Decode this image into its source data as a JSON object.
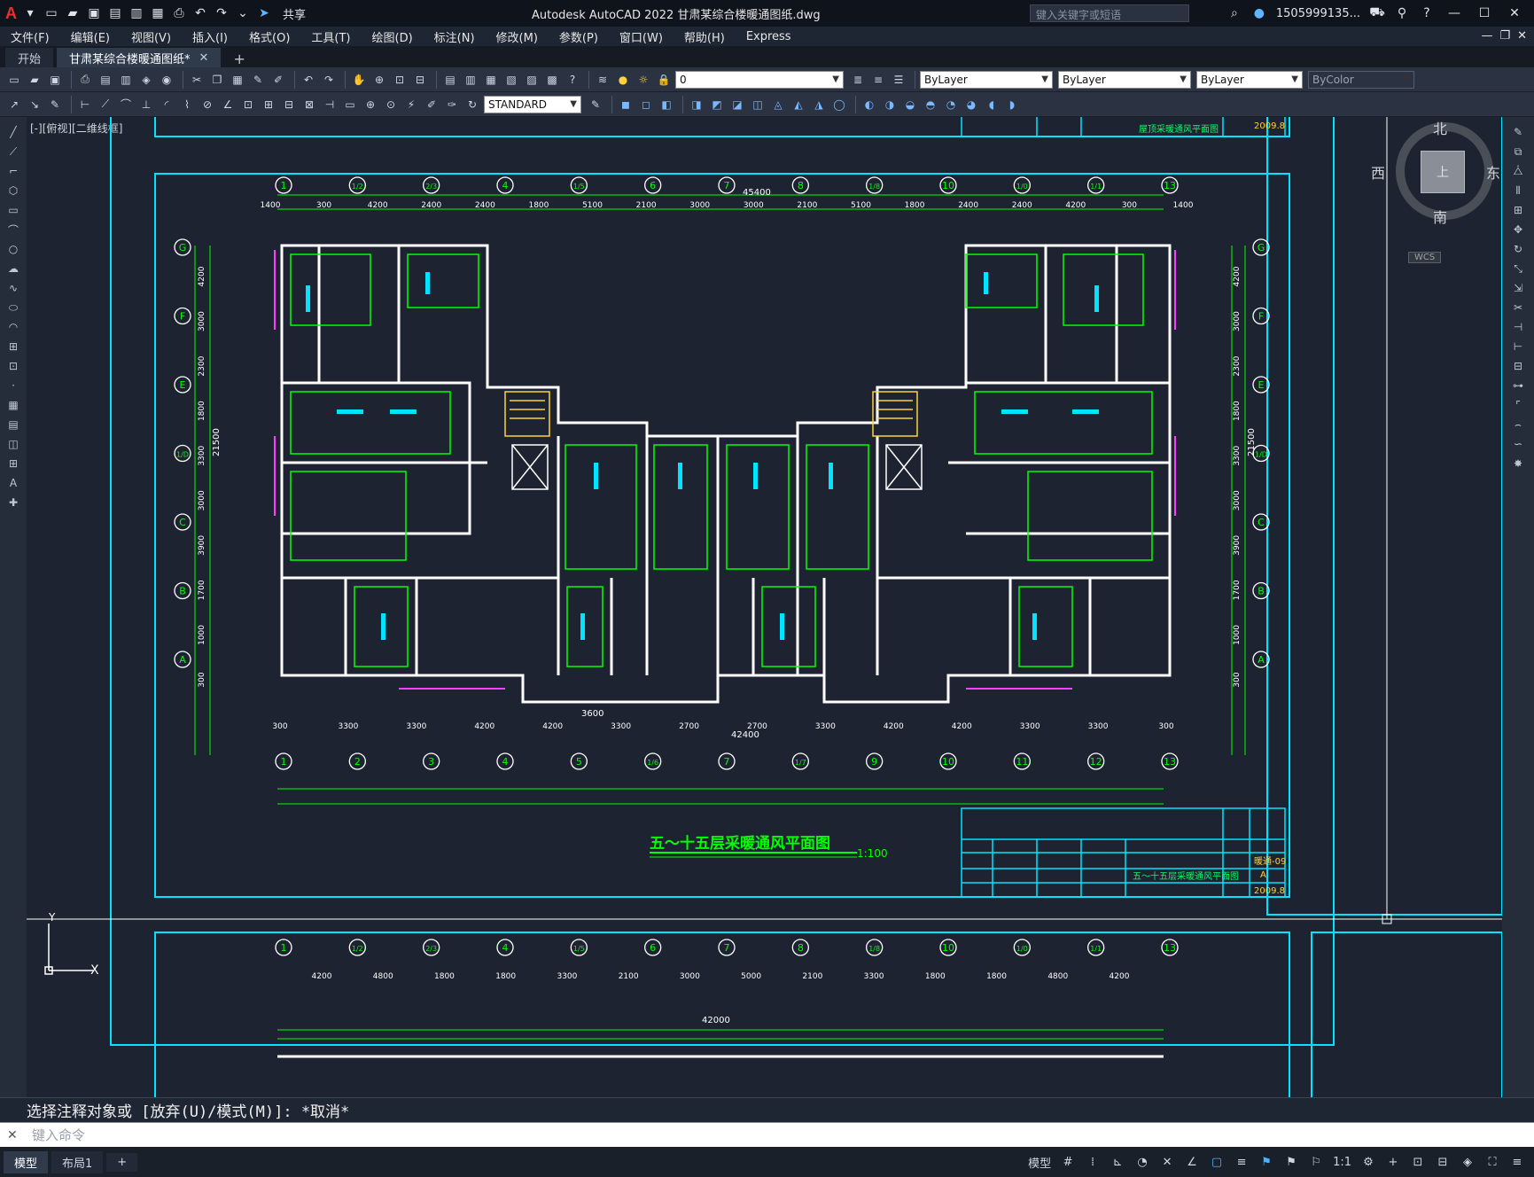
{
  "title_bar": {
    "app_title": "Autodesk AutoCAD 2022    甘肃某综合楼暖通图纸.dwg",
    "share_label": "共享",
    "search_placeholder": "键入关键字或短语",
    "user": "1505999135...",
    "logo": "A"
  },
  "menu": {
    "items": [
      "文件(F)",
      "编辑(E)",
      "视图(V)",
      "插入(I)",
      "格式(O)",
      "工具(T)",
      "绘图(D)",
      "标注(N)",
      "修改(M)",
      "参数(P)",
      "窗口(W)",
      "帮助(H)",
      "Express"
    ]
  },
  "tabs": {
    "start": "开始",
    "active": "甘肃某综合楼暖通图纸*",
    "add": "+"
  },
  "toolbar": {
    "layer_value": "0",
    "bylayer_color": "ByLayer",
    "bylayer_linetype": "ByLayer",
    "bylayer_lineweight": "ByLayer",
    "bycolor": "ByColor",
    "text_style": "STANDARD"
  },
  "viewport": {
    "label": "[-][俯视][二维线框]"
  },
  "viewcube": {
    "north": "北",
    "south": "南",
    "east": "东",
    "west": "西",
    "face": "上",
    "wcs": "WCS"
  },
  "drawing": {
    "plan_title": "五～十五层采暖通风平面图",
    "scale": "1:100",
    "top_dim_total": "45400",
    "bottom_dim_total": "42400",
    "lower_plan_total": "42000",
    "grid_top": [
      "1",
      "1/2",
      "2/3",
      "4",
      "1/5",
      "6",
      "7",
      "8",
      "1/8",
      "10",
      "1/0",
      "1/1",
      "13"
    ],
    "grid_bottom": [
      "1",
      "2",
      "3",
      "4",
      "5",
      "1/6",
      "7",
      "1/7",
      "9",
      "10",
      "11",
      "12",
      "13"
    ],
    "grid_rows": [
      "G",
      "F",
      "E",
      "1/D",
      "C",
      "B",
      "A"
    ],
    "top_dims": [
      "1400",
      "300",
      "4200",
      "2400",
      "2400",
      "1800",
      "5100",
      "2100",
      "3000",
      "3000",
      "2100",
      "5100",
      "1800",
      "2400",
      "2400",
      "4200",
      "300",
      "1400"
    ],
    "bottom_dims": [
      "300",
      "3300",
      "3300",
      "4200",
      "4200",
      "3300",
      "2700",
      "2700",
      "3300",
      "4200",
      "4200",
      "3300",
      "3300",
      "300"
    ],
    "bottom_sub_dim": "3600",
    "side_dims": [
      "4200",
      "3000",
      "2300",
      "1800",
      "3300",
      "3000",
      "3900",
      "1700",
      "1000",
      "300"
    ],
    "side_total": "21500",
    "lower_dims": [
      "4200",
      "4800",
      "1800",
      "1800",
      "3300",
      "2100",
      "3000",
      "5000",
      "2100",
      "3300",
      "1800",
      "1800",
      "4800",
      "4200"
    ],
    "title_block_date": "2009.8",
    "title_block_sheet": "暖通-09",
    "title_block_rev": "A",
    "title_block_name": "五～十五层采暖通风平面图",
    "top_title_block_name": "屋顶采暖通风平面图"
  },
  "command": {
    "history": "选择注释对象或 [放弃(U)/模式(M)]: *取消*",
    "placeholder": "键入命令"
  },
  "status": {
    "model_tab": "模型",
    "layout_tab": "布局1",
    "add": "+",
    "model_label": "模型",
    "scale": "1:1"
  },
  "colors": {
    "background": "#1d2330",
    "frame": "#00e5ff",
    "walls": "#ffffff",
    "grid": "#00ff00",
    "accent": "#e8312f"
  }
}
